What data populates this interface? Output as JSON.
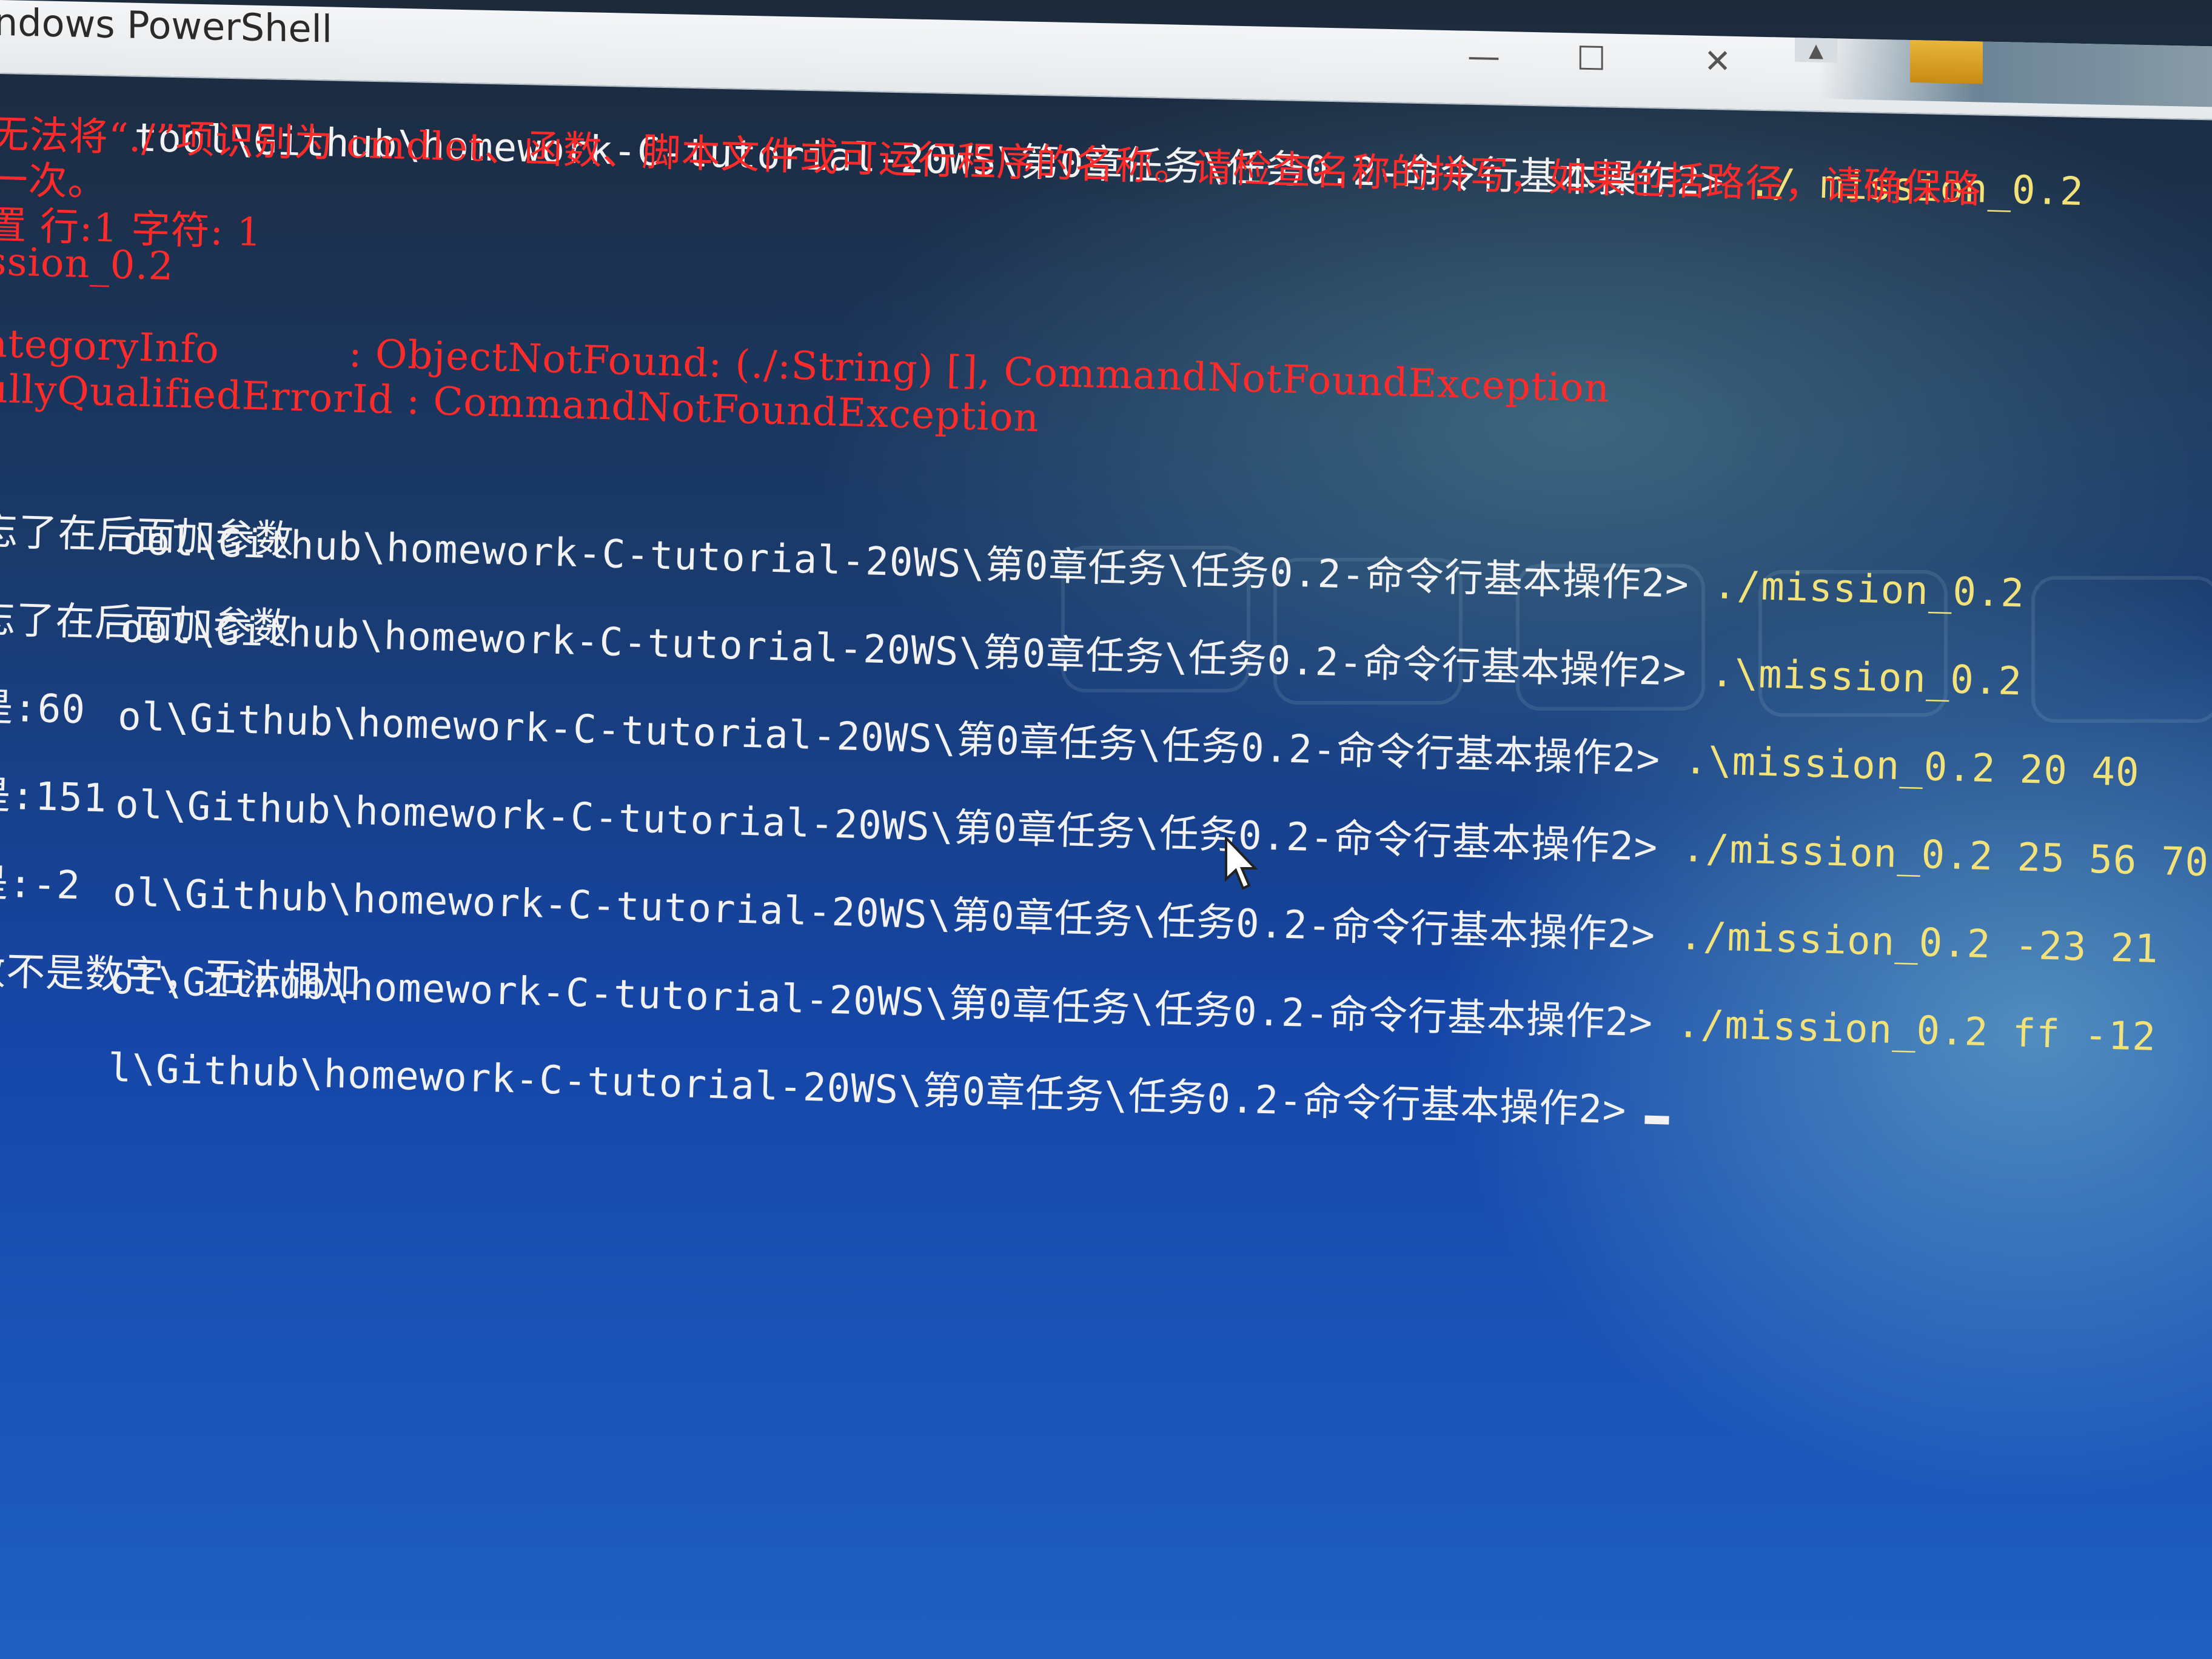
{
  "window": {
    "title": "ndows PowerShell",
    "min_glyph": "—",
    "max_glyph": "☐",
    "close_glyph": "✕"
  },
  "console": {
    "lines": [
      {
        "prompt": "tool\\Github\\homework-C-tutorial-20WS\\第0章任务\\任务0.2-命令行基本操作2>",
        "cmd": " ./ mission_0.2"
      },
      {
        "text": "无法将“./”项识别为 cmdlet、函数、脚本文件或可运行程序的名称。请检查名称的拼写，如果包括路径，请确保路"
      },
      {
        "text": "一次。"
      },
      {
        "text": "置 行:1 字符: 1"
      },
      {
        "text": "ssion_0.2"
      },
      {
        "text": "ategoryInfo          : ObjectNotFound: (./:String) [], CommandNotFoundException"
      },
      {
        "text": "ullyQualifiedErrorId : CommandNotFoundException"
      },
      {
        "prompt": "ool\\Github\\homework-C-tutorial-20WS\\第0章任务\\任务0.2-命令行基本操作2>",
        "cmd": " ./mission_0.2"
      },
      {
        "text": "忘了在后面加参数"
      },
      {
        "prompt": "ool\\Github\\homework-C-tutorial-20WS\\第0章任务\\任务0.2-命令行基本操作2>",
        "cmd": " .\\mission_0.2"
      },
      {
        "text": "忘了在后面加参数"
      },
      {
        "prompt": "ol\\Github\\homework-C-tutorial-20WS\\第0章任务\\任务0.2-命令行基本操作2>",
        "cmd": " .\\mission_0.2 20 40"
      },
      {
        "text": "是:60"
      },
      {
        "prompt": "ol\\Github\\homework-C-tutorial-20WS\\第0章任务\\任务0.2-命令行基本操作2>",
        "cmd": " ./mission_0.2 25 56 70"
      },
      {
        "text": "是:151"
      },
      {
        "prompt": "ol\\Github\\homework-C-tutorial-20WS\\第0章任务\\任务0.2-命令行基本操作2>",
        "cmd": " ./mission_0.2 -23 21"
      },
      {
        "text": "是:-2"
      },
      {
        "prompt": "ol\\Github\\homework-C-tutorial-20WS\\第0章任务\\任务0.2-命令行基本操作2>",
        "cmd": " ./mission_0.2 ff -12"
      },
      {
        "text": "数不是数字，无法相加"
      },
      {
        "prompt": "l\\Github\\homework-C-tutorial-20WS\\第0章任务\\任务0.2-命令行基本操作2>",
        "cmd": ""
      }
    ]
  },
  "colors": {
    "error_text": "#ff2a2a",
    "normal_text": "#f2f2f2",
    "command_text": "#f3e27a",
    "console_background": "#1546a8"
  },
  "icons": {
    "mouse": "mouse-pointer-icon"
  }
}
